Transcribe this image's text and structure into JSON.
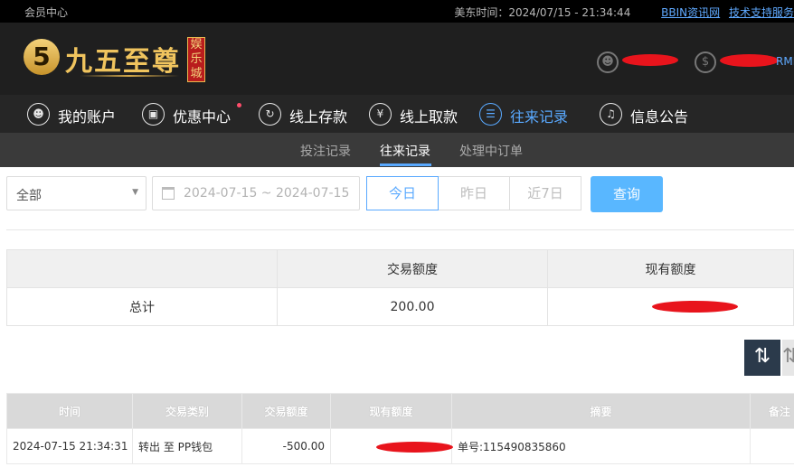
{
  "topbar": {
    "left_label": "会员中心",
    "time_label": "美东时间：2024/07/15 - 21:34:44",
    "link_bbin": "BBIN资讯网",
    "link_support": "技术支持服务"
  },
  "logo": {
    "mark": "5",
    "name": "九五至尊",
    "tag": "娱乐城"
  },
  "user": {
    "currency_suffix": "RMB",
    "user_icon": "user-icon",
    "balance_icon": "dollar-icon"
  },
  "nav": {
    "items": [
      {
        "label": "我的账户",
        "icon": "account-icon"
      },
      {
        "label": "优惠中心",
        "icon": "gift-icon"
      },
      {
        "label": "线上存款",
        "icon": "deposit-icon"
      },
      {
        "label": "线上取款",
        "icon": "withdraw-icon"
      },
      {
        "label": "往来记录",
        "icon": "record-icon"
      },
      {
        "label": "信息公告",
        "icon": "bell-icon"
      }
    ],
    "active": "往来记录"
  },
  "subnav": {
    "items": [
      "投注记录",
      "往来记录",
      "处理中订单"
    ],
    "active": "往来记录"
  },
  "filters": {
    "type_value": "全部",
    "date_range": "2024-07-15 ~ 2024-07-15",
    "quick_ranges": [
      "今日",
      "昨日",
      "近7日"
    ],
    "active_range": "今日",
    "query_label": "查询"
  },
  "summary": {
    "headers": [
      "",
      "交易额度",
      "现有额度"
    ],
    "row_label": "总计",
    "amount": "200.00"
  },
  "details": {
    "headers": [
      "时间",
      "交易类别",
      "交易额度",
      "现有额度",
      "摘要",
      "备注"
    ],
    "rows": [
      {
        "time": "2024-07-15 21:34:31",
        "type": "转出 至 PP钱包",
        "amount": "-500.00",
        "summary": "单号:115490835860"
      }
    ]
  },
  "colors": {
    "accent": "#59a9ff",
    "redaction": "#e8141c",
    "nav_bg": "#262626"
  }
}
